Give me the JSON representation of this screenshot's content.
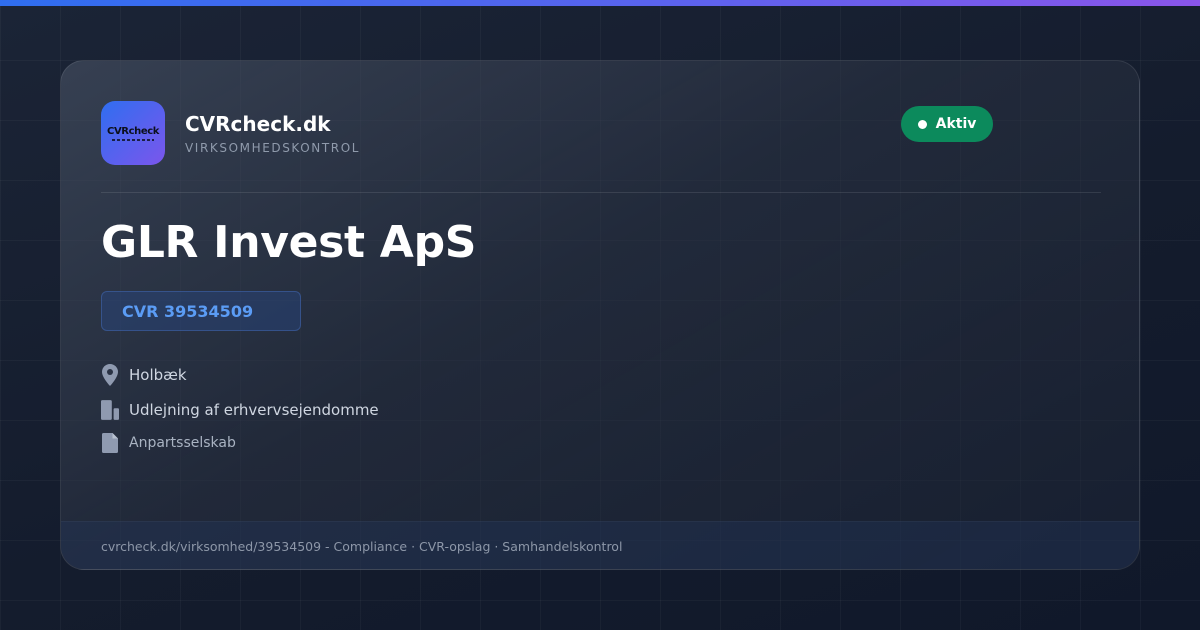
{
  "brand": {
    "logo_text": "CVRcheck",
    "name": "CVRcheck.dk",
    "tagline": "VIRKSOMHEDSKONTROL"
  },
  "status": {
    "label": "Aktiv",
    "color": "#0c8a5c"
  },
  "company": {
    "name": "GLR Invest ApS",
    "cvr": "CVR 39534509",
    "location": "Holbæk",
    "industry": "Udlejning af erhvervsejendomme",
    "company_type": "Anpartsselskab"
  },
  "icons": {
    "location": "map-pin-icon",
    "industry": "building-icon",
    "company_type": "document-icon"
  },
  "footer": {
    "text": "cvrcheck.dk/virksomhed/39534509 - Compliance · CVR-opslag · Samhandelskontrol"
  },
  "colors": {
    "accent_start": "#2f6ef0",
    "accent_end": "#8a55ea",
    "cvr_text": "#5b9cf5",
    "background": "#121a2b"
  }
}
